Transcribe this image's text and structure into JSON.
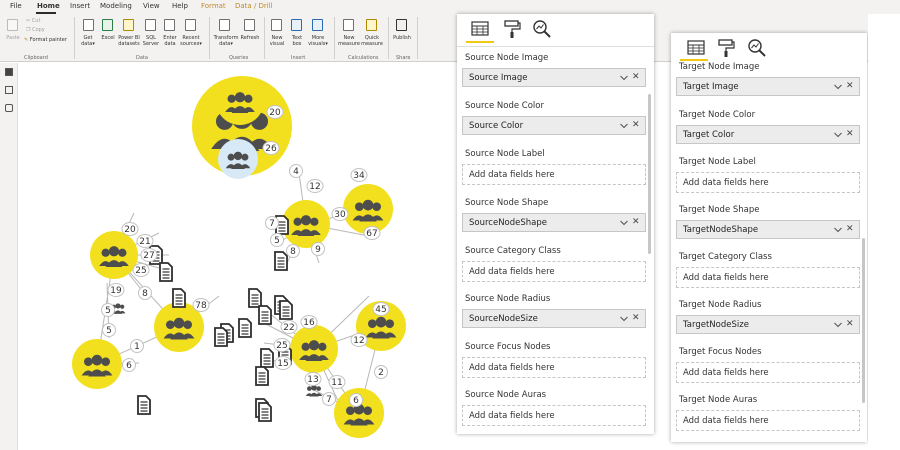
{
  "menu": {
    "items": [
      "File",
      "Home",
      "Insert",
      "Modeling",
      "View",
      "Help",
      "Format",
      "Data / Drill"
    ]
  },
  "ribbon": {
    "clipboard": {
      "paste": "Paste",
      "cut": "Cut",
      "copy": "Copy",
      "format_painter": "Format painter",
      "group": "Clipboard"
    },
    "data": {
      "get_data": [
        "Get",
        "data"
      ],
      "excel": "Excel",
      "power_bi": [
        "Power BI",
        "datasets"
      ],
      "sql": [
        "SQL",
        "Server"
      ],
      "enter_data": [
        "Enter",
        "data"
      ],
      "recent_sources": [
        "Recent",
        "sources"
      ],
      "group": "Data"
    },
    "queries": {
      "transform": [
        "Transform",
        "data"
      ],
      "refresh": "Refresh",
      "group": "Queries"
    },
    "insert": {
      "new_visual": [
        "New",
        "visual"
      ],
      "text_box": [
        "Text",
        "box"
      ],
      "more_visuals": [
        "More",
        "visuals"
      ],
      "group": "Insert"
    },
    "calculations": {
      "new_measure": [
        "New",
        "measure"
      ],
      "quick_measure": [
        "Quick",
        "measure"
      ],
      "group": "Calculations"
    },
    "share": {
      "publish": "Publish",
      "group": "Share"
    }
  },
  "colors": {
    "node_yellow": "#f2e01f",
    "node_blue": "#d7e9f7",
    "icon_dark": "#4d4d4d",
    "edge": "#b8b8b8",
    "accent": "#f2c811"
  },
  "graph": {
    "nodes": [
      {
        "id": "n1",
        "icon": "people-icon",
        "color": "yellow"
      },
      {
        "id": "n2",
        "icon": "people-icon",
        "color": "yellow"
      },
      {
        "id": "n3",
        "icon": "people-icon",
        "color": "blue"
      },
      {
        "id": "n4",
        "icon": "people-icon",
        "color": "yellow"
      },
      {
        "id": "n5",
        "icon": "people-icon",
        "color": "yellow"
      },
      {
        "id": "n6",
        "icon": "people-icon",
        "color": "yellow"
      },
      {
        "id": "n7",
        "icon": "people-icon",
        "color": "yellow"
      },
      {
        "id": "n8",
        "icon": "people-icon",
        "color": "yellow"
      },
      {
        "id": "n9",
        "icon": "people-icon",
        "color": "yellow"
      },
      {
        "id": "n10",
        "icon": "people-icon",
        "color": "yellow"
      },
      {
        "id": "n11",
        "icon": "people-icon",
        "color": "yellow"
      },
      {
        "id": "n12",
        "icon": "people-icon",
        "color": "none"
      },
      {
        "id": "n13",
        "icon": "people-icon",
        "color": "none"
      }
    ],
    "edge_labels": [
      "20",
      "26",
      "4",
      "12",
      "34",
      "30",
      "7",
      "5",
      "8",
      "9",
      "67",
      "20",
      "21",
      "27",
      "25",
      "8",
      "19",
      "5",
      "5",
      "78",
      "1",
      "6",
      "22",
      "16",
      "45",
      "12",
      "25",
      "15",
      "13",
      "11",
      "6",
      "2",
      "7"
    ]
  },
  "source_pane": {
    "fields": [
      {
        "label": "Source Node Image",
        "value": "Source Image",
        "filled": true
      },
      {
        "label": "Source Node Color",
        "value": "Source Color",
        "filled": true
      },
      {
        "label": "Source Node Label",
        "value": "Add data fields here",
        "filled": false
      },
      {
        "label": "Source Node Shape",
        "value": "SourceNodeShape",
        "filled": true
      },
      {
        "label": "Source Category Class",
        "value": "Add data fields here",
        "filled": false
      },
      {
        "label": "Source Node Radius",
        "value": "SourceNodeSize",
        "filled": true
      },
      {
        "label": "Source Focus Nodes",
        "value": "Add data fields here",
        "filled": false
      },
      {
        "label": "Source Node Auras",
        "value": "Add data fields here",
        "filled": false
      }
    ]
  },
  "target_pane": {
    "fields": [
      {
        "label": "Target Node Image",
        "value": "Target Image",
        "filled": true
      },
      {
        "label": "Target Node Color",
        "value": "Target Color",
        "filled": true
      },
      {
        "label": "Target Node Label",
        "value": "Add data fields here",
        "filled": false
      },
      {
        "label": "Target Node Shape",
        "value": "TargetNodeShape",
        "filled": true
      },
      {
        "label": "Target Category Class",
        "value": "Add data fields here",
        "filled": false
      },
      {
        "label": "Target Node Radius",
        "value": "TargetNodeSize",
        "filled": true
      },
      {
        "label": "Target Focus Nodes",
        "value": "Add data fields here",
        "filled": false
      },
      {
        "label": "Target Node Auras",
        "value": "Add data fields here",
        "filled": false
      }
    ]
  }
}
